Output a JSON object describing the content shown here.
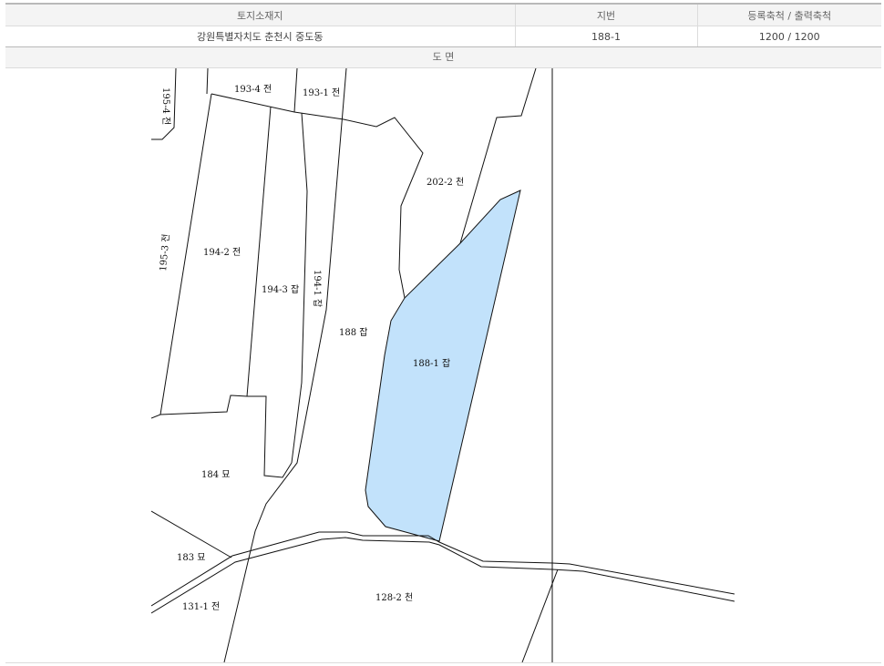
{
  "table": {
    "headers": [
      "토지소재지",
      "지번",
      "등록축척 / 출력축척"
    ],
    "values": [
      "강원특별자치도 춘천시 중도동",
      "188-1",
      "1200 / 1200"
    ]
  },
  "map": {
    "header": "도 면",
    "highlight_color": "#c2e2fb",
    "parcels": {
      "p193_4": "193-4 전",
      "p193_1": "193-1 전",
      "p195_4": "195-4 전",
      "p202_2": "202-2 천",
      "p195_3": "195-3 전",
      "p194_2": "194-2 전",
      "p194_3": "194-3 잡",
      "p194_1": "194-1 잡",
      "p188": "188 잡",
      "p188_1": "188-1 잡",
      "p184": "184 묘",
      "p183": "183 묘",
      "p131_1": "131-1 전",
      "p128_2": "128-2 천"
    }
  }
}
